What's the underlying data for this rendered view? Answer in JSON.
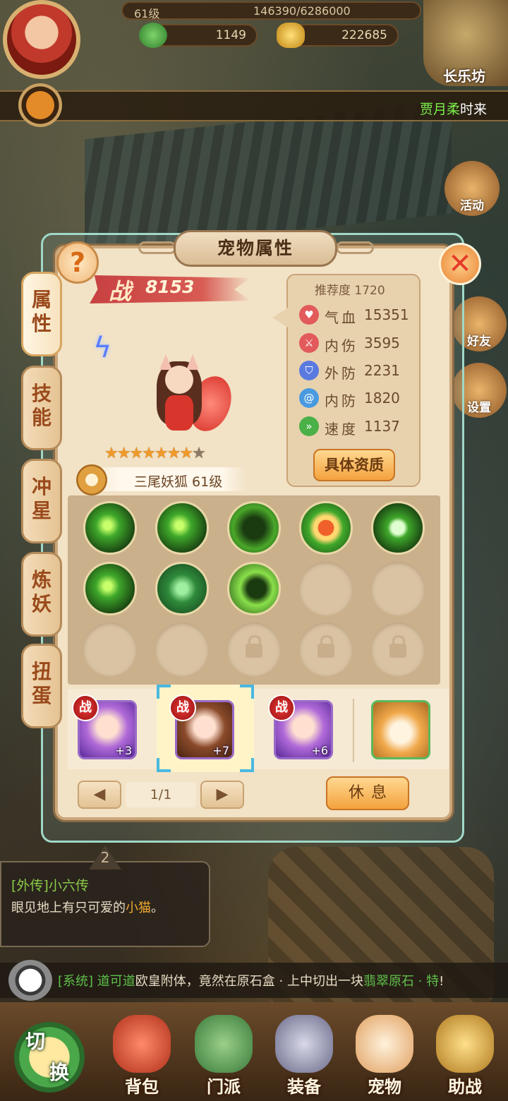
{
  "top_bar": {
    "level": "61级",
    "exp": "146390/6286000",
    "jade": "1149",
    "gold": "222685",
    "city": "长乐坊"
  },
  "broadcast": {
    "name": "贾月柔",
    "suffix": "时来"
  },
  "side_menu": {
    "activity": "活动",
    "friends": "好友",
    "settings": "设置"
  },
  "panel": {
    "title": "宠物属性",
    "help": "?",
    "close": "✕"
  },
  "tabs": [
    {
      "label": [
        "属",
        "性"
      ]
    },
    {
      "label": [
        "技",
        "能"
      ]
    },
    {
      "label": [
        "冲",
        "星"
      ]
    },
    {
      "label": [
        "炼",
        "妖"
      ]
    },
    {
      "label": [
        "扭",
        "蛋"
      ]
    }
  ],
  "pet": {
    "power_label": "战",
    "power": "8153",
    "stars_filled": "★★★★★★★",
    "stars_empty": "★",
    "star_count": 7,
    "star_max": 8,
    "name": "三尾妖狐 61级"
  },
  "stats": {
    "recommend": "推荐度 1720",
    "rows": [
      {
        "label": "气血",
        "value": "15351",
        "icon": "heart-icon",
        "color": "#e25a5a"
      },
      {
        "label": "内伤",
        "value": "3595",
        "icon": "sword-icon",
        "color": "#e25a5a"
      },
      {
        "label": "外防",
        "value": "2231",
        "icon": "shield-icon",
        "color": "#5a7ae0"
      },
      {
        "label": "内防",
        "value": "1820",
        "icon": "swirl-icon",
        "color": "#4a9ae0"
      },
      {
        "label": "速度",
        "value": "1137",
        "icon": "boot-icon",
        "color": "#4ab048"
      }
    ],
    "aptitude_button": "具体资质"
  },
  "roster": {
    "battle_badge": "战",
    "pets": [
      {
        "plus": "+3"
      },
      {
        "plus": "+7"
      },
      {
        "plus": "+6"
      },
      {
        "plus": ""
      }
    ]
  },
  "pager": {
    "prev": "◀",
    "page": "1/1",
    "next": "▶",
    "rest": "休息"
  },
  "quest": {
    "number": "2",
    "title": "[外传]小六传",
    "desc_prefix": "眼见地上有只可爱的",
    "desc_highlight": "小猫",
    "desc_suffix": "。"
  },
  "chat": {
    "channel": "[系统]",
    "name": "道可道",
    "message": "欧皇附体，竟然在原石盒 · 上中切出一块",
    "item": "翡翠原石 · 特",
    "end": "!"
  },
  "bottom_nav": {
    "switch_top": "切",
    "switch_bottom": "换",
    "items": [
      {
        "label": "背包"
      },
      {
        "label": "门派"
      },
      {
        "label": "装备"
      },
      {
        "label": "宠物"
      },
      {
        "label": "助战"
      }
    ]
  }
}
